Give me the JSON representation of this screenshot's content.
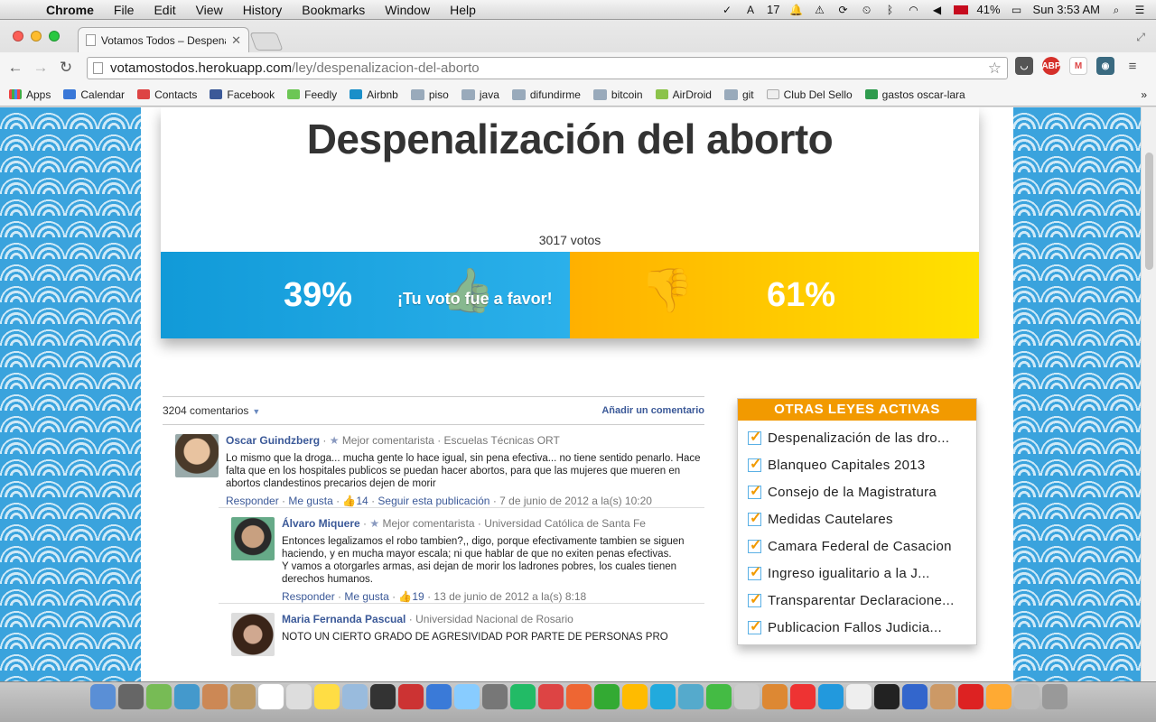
{
  "menubar": {
    "app_name": "Chrome",
    "items": [
      "File",
      "Edit",
      "View",
      "History",
      "Bookmarks",
      "Window",
      "Help"
    ],
    "status": {
      "notification_count": "17",
      "battery": "41%",
      "clock": "Sun 3:53 AM"
    }
  },
  "browser": {
    "tab_title": "Votamos Todos – Despena",
    "url_host": "votamostodos.herokuapp.com",
    "url_path": "/ley/despenalizacion-del-aborto",
    "extensions": [
      "ABP"
    ],
    "bookmarks": [
      "Apps",
      "Calendar",
      "Contacts",
      "Facebook",
      "Feedly",
      "Airbnb",
      "piso",
      "java",
      "difundirme",
      "bitcoin",
      "AirDroid",
      "git",
      "Club Del Sello",
      "gastos oscar-lara"
    ]
  },
  "law": {
    "title": "Despenalización del aborto",
    "votes_label": "3017 votos",
    "yes_fraction": 0.5,
    "yes_pct": "39%",
    "no_pct": "61%",
    "your_vote": "¡Tu voto fue a favor!",
    "yes_color": "#119ad8",
    "no_color": "#ffb000"
  },
  "comments": {
    "count_label": "3204 comentarios",
    "add_label": "Añadir un comentario",
    "items": [
      {
        "name": "Oscar Guindzberg",
        "badge": "Mejor comentarista",
        "affiliation": "Escuelas Técnicas ORT",
        "text": "Lo mismo que la droga... mucha gente lo hace igual, sin pena efectiva... no tiene sentido penarlo. Hace falta que en los hospitales publicos se puedan hacer abortos, para que las mujeres que mueren en abortos clandestinos precarios dejen de morir",
        "reply": "Responder",
        "like": "Me gusta",
        "likes": "14",
        "follow": "Seguir esta publicación",
        "date": "7 de junio de 2012 a la(s) 10:20"
      },
      {
        "name": "Álvaro Miquere",
        "badge": "Mejor comentarista",
        "affiliation": "Universidad Católica de Santa Fe",
        "text": "Entonces legalizamos el robo tambien?,, digo, porque efectivamente tambien se siguen haciendo, y en mucha mayor escala; ni que hablar de que no exiten penas efectivas.\nY vamos a otorgarles armas, asi dejan de morir los ladrones pobres, los cuales tienen derechos humanos.",
        "reply": "Responder",
        "like": "Me gusta",
        "likes": "19",
        "date": "13 de junio de 2012 a la(s) 8:18"
      },
      {
        "name": "Maria Fernanda Pascual",
        "affiliation": "Universidad Nacional de Rosario",
        "text": "NOTO UN CIERTO GRADO DE AGRESIVIDAD POR PARTE DE PERSONAS PRO"
      }
    ]
  },
  "sidebar": {
    "title": "OTRAS LEYES ACTIVAS",
    "items": [
      "Despenalización de las dro...",
      "Blanqueo Capitales 2013",
      "Consejo de la Magistratura",
      "Medidas Cautelares",
      "Camara Federal de Casacion",
      "Ingreso igualitario a la J...",
      "Transparentar Declaracione...",
      "Publicacion Fallos Judicia..."
    ]
  }
}
